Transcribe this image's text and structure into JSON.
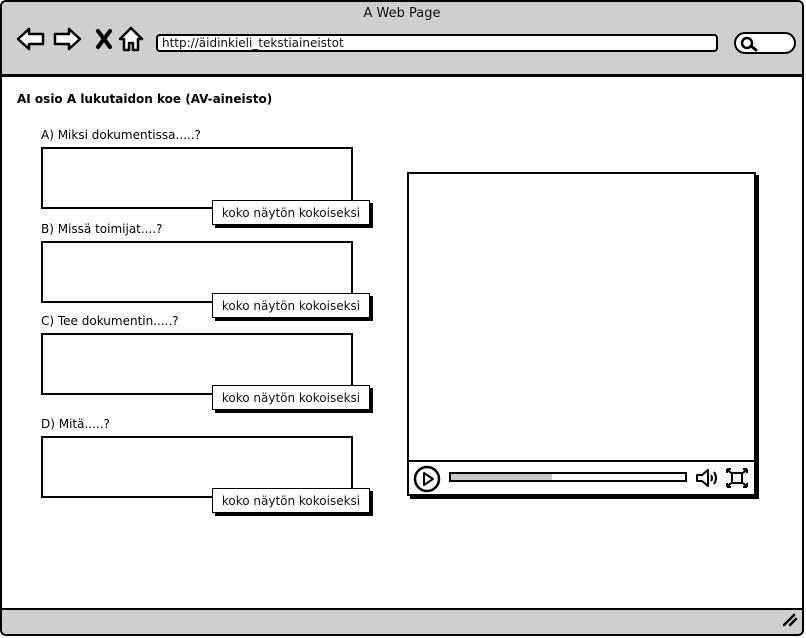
{
  "window": {
    "title": "A Web Page"
  },
  "browser": {
    "url": "http://äidinkieli_tekstiaineistot",
    "search_value": ""
  },
  "page": {
    "heading": "AI osio A lukutaidon koe (AV-aineisto)",
    "questions": [
      {
        "label": "A) Miksi dokumentissa.....?",
        "button_label": "koko näytön kokoiseksi",
        "answer": ""
      },
      {
        "label": "B) Missä toimijat....?",
        "button_label": "koko näytön kokoiseksi",
        "answer": ""
      },
      {
        "label": "C) Tee dokumentin.....?",
        "button_label": "koko näytön kokoiseksi",
        "answer": ""
      },
      {
        "label": "D) Mitä.....?",
        "button_label": "koko näytön kokoiseksi",
        "answer": ""
      }
    ]
  },
  "video_player": {
    "progress": 0.43
  },
  "icons": {
    "back": "back-arrow-icon",
    "forward": "forward-arrow-icon",
    "stop": "close-icon",
    "home": "home-icon",
    "search": "search-icon",
    "play": "play-icon",
    "volume": "volume-icon",
    "fullscreen": "fullscreen-icon",
    "resize": "resize-grip-icon"
  }
}
